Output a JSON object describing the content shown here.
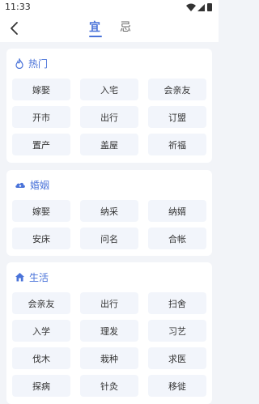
{
  "status": {
    "time": "11:33"
  },
  "tabs": [
    {
      "label": "宜"
    },
    {
      "label": "忌"
    }
  ],
  "sections": [
    {
      "title": "热门",
      "icon": "fire-icon",
      "items": [
        "嫁娶",
        "入宅",
        "会亲友",
        "开市",
        "出行",
        "订盟",
        "置产",
        "盖屋",
        "祈福"
      ]
    },
    {
      "title": "婚姻",
      "icon": "cloud-heart-icon",
      "items": [
        "嫁娶",
        "纳采",
        "纳婿",
        "安床",
        "问名",
        "合帐"
      ]
    },
    {
      "title": "生活",
      "icon": "house-icon",
      "items": [
        "会亲友",
        "出行",
        "扫舍",
        "入学",
        "理发",
        "习艺",
        "伐木",
        "栽种",
        "求医",
        "探病",
        "针灸",
        "移徙"
      ]
    }
  ],
  "colors": {
    "accent": "#4a73d9",
    "cell_bg": "#f2f5fb",
    "page_bg": "#f2f4f8"
  }
}
